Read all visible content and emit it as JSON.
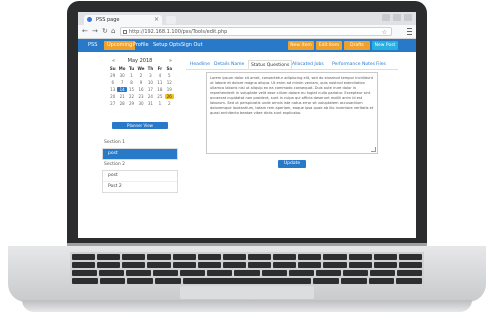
{
  "browser": {
    "tab_title": "PSS page",
    "url": "http://192.168.1.100/pss/Tools/edit.php"
  },
  "app_nav": {
    "logo": "PSS",
    "items": [
      "Upcoming",
      "Profile",
      "Setup Opts",
      "Sign Out"
    ],
    "right_buttons": [
      {
        "label": "New Item",
        "color": "#f0a12c"
      },
      {
        "label": "Edit Item",
        "color": "#f0a12c"
      },
      {
        "label": "Drafts",
        "color": "#f0a12c"
      },
      {
        "label": "New Post",
        "color": "#27b0e0"
      }
    ]
  },
  "calendar": {
    "month": "May 2018",
    "prev": "«",
    "next": "»",
    "days_of_week": [
      "Su",
      "Mo",
      "Tu",
      "We",
      "Th",
      "Fr",
      "Sa"
    ],
    "days": [
      "29",
      "30",
      "1",
      "2",
      "3",
      "4",
      "5",
      "6",
      "7",
      "8",
      "9",
      "10",
      "11",
      "12",
      "13",
      "14",
      "15",
      "16",
      "17",
      "18",
      "19",
      "20",
      "21",
      "22",
      "23",
      "24",
      "25",
      "26",
      "27",
      "28",
      "29",
      "30",
      "31",
      "1",
      "2"
    ],
    "today": "14",
    "highlight": "26",
    "button": "Planner View"
  },
  "groups": [
    {
      "label": "Section 1",
      "items": [
        "post"
      ],
      "selected": "post"
    },
    {
      "label": "Section 2",
      "items": [
        "post",
        "Post 2"
      ],
      "selected": ""
    }
  ],
  "main": {
    "tabs": [
      "Headline",
      "Details Name",
      "Status Questions",
      "Allocated Jobs",
      "Performance Notes",
      "Files"
    ],
    "active_tab": "Status Questions",
    "text": "Lorem ipsum dolor sit amet, consectetur adipiscing elit, sed do eiusmod tempor incididunt ut labore et dolore magna aliqua. Ut enim ad minim veniam, quis nostrud exercitation ullamco laboris nisi ut aliquip ex ea commodo consequat. Duis aute irure dolor in reprehenderit in voluptate velit esse cillum dolore eu fugiat nulla pariatur. Excepteur sint occaecat cupidatat non proident, sunt in culpa qui officia deserunt mollit anim id est laborum. Sed ut perspiciatis unde omnis iste natus error sit voluptatem accusantium doloremque laudantium, totam rem aperiam, eaque ipsa quae ab illo inventore veritatis et quasi architecto beatae vitae dicta sunt explicabo.",
    "submit": "Update"
  }
}
